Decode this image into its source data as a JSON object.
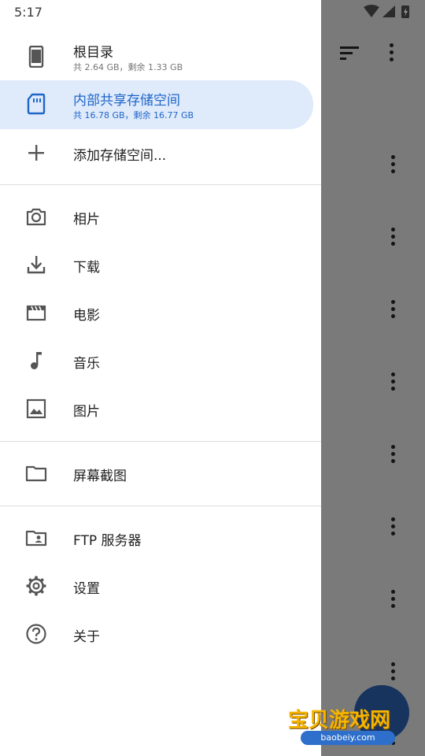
{
  "status_bar": {
    "time": "5:17"
  },
  "drawer": {
    "storage": [
      {
        "label": "根目录",
        "sub": "共 2.64 GB，剩余 1.33 GB",
        "icon": "phone-icon"
      },
      {
        "label": "内部共享存储空间",
        "sub": "共 16.78 GB，剩余 16.77 GB",
        "icon": "sd-card-icon",
        "active": true
      },
      {
        "label": "添加存储空间...",
        "icon": "plus-icon"
      }
    ],
    "media": [
      {
        "label": "相片",
        "icon": "camera-icon"
      },
      {
        "label": "下载",
        "icon": "download-icon"
      },
      {
        "label": "电影",
        "icon": "movie-icon"
      },
      {
        "label": "音乐",
        "icon": "music-icon"
      },
      {
        "label": "图片",
        "icon": "image-icon"
      }
    ],
    "folders": [
      {
        "label": "屏幕截图",
        "icon": "folder-icon"
      }
    ],
    "tools": [
      {
        "label": "FTP 服务器",
        "icon": "ftp-folder-icon"
      },
      {
        "label": "设置",
        "icon": "gear-icon"
      },
      {
        "label": "关于",
        "icon": "help-icon"
      }
    ]
  },
  "watermark": {
    "title": "宝贝游戏网",
    "url": "baobeiy.com"
  },
  "colors": {
    "accent": "#1f66c8",
    "active_bg": "#dfeafb",
    "scrim": "rgba(0,0,0,0.52)",
    "watermark_text": "#f4b400"
  }
}
